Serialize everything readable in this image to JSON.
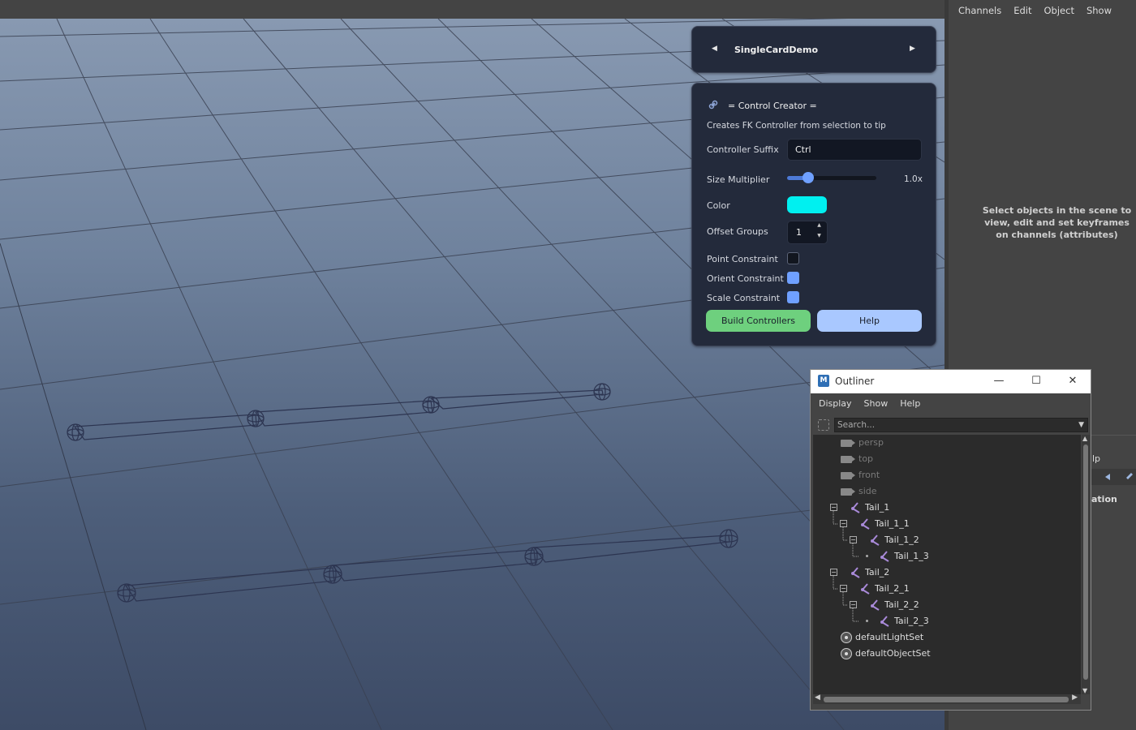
{
  "channel_box": {
    "menu": [
      "Channels",
      "Edit",
      "Object",
      "Show"
    ],
    "empty_message": "Select objects in the scene to view, edit and set keyframes on channels (attributes)"
  },
  "layer_panel": {
    "help_partial": "lp",
    "anim_partial": "ation"
  },
  "card_nav": {
    "title": "SingleCardDemo",
    "prev_icon": "left-arrow-icon",
    "next_icon": "right-arrow-icon"
  },
  "control_creator": {
    "icon": "link-icon",
    "title": "= Control Creator =",
    "description": "Creates FK Controller from selection to tip",
    "suffix_label": "Controller Suffix",
    "suffix_value": "Ctrl",
    "size_label": "Size Multiplier",
    "size_value_text": "1.0x",
    "size_slider_fraction": 0.24,
    "color_label": "Color",
    "color_value": "#00f0f0",
    "offset_label": "Offset Groups",
    "offset_value": "1",
    "point_label": "Point Constraint",
    "point_checked": false,
    "orient_label": "Orient Constraint",
    "orient_checked": true,
    "scale_label": "Scale Constraint",
    "scale_checked": true,
    "build_label": "Build Controllers",
    "help_label": "Help",
    "accent_color": "#6fa0ff",
    "build_color": "#6ed07e"
  },
  "outliner": {
    "title": "Outliner",
    "app_icon": "M",
    "menu": [
      "Display",
      "Show",
      "Help"
    ],
    "search_placeholder": "Search...",
    "items": [
      {
        "label": "persp",
        "kind": "camera",
        "depth": 0
      },
      {
        "label": "top",
        "kind": "camera",
        "depth": 0
      },
      {
        "label": "front",
        "kind": "camera",
        "depth": 0
      },
      {
        "label": "side",
        "kind": "camera",
        "depth": 0
      },
      {
        "label": "Tail_1",
        "kind": "joint",
        "depth": 0
      },
      {
        "label": "Tail_1_1",
        "kind": "joint",
        "depth": 1
      },
      {
        "label": "Tail_1_2",
        "kind": "joint",
        "depth": 2
      },
      {
        "label": "Tail_1_3",
        "kind": "joint",
        "depth": 3
      },
      {
        "label": "Tail_2",
        "kind": "joint",
        "depth": 0
      },
      {
        "label": "Tail_2_1",
        "kind": "joint",
        "depth": 1
      },
      {
        "label": "Tail_2_2",
        "kind": "joint",
        "depth": 2
      },
      {
        "label": "Tail_2_3",
        "kind": "joint",
        "depth": 3
      },
      {
        "label": "defaultLightSet",
        "kind": "set",
        "depth": 0
      },
      {
        "label": "defaultObjectSet",
        "kind": "set",
        "depth": 0
      }
    ]
  }
}
